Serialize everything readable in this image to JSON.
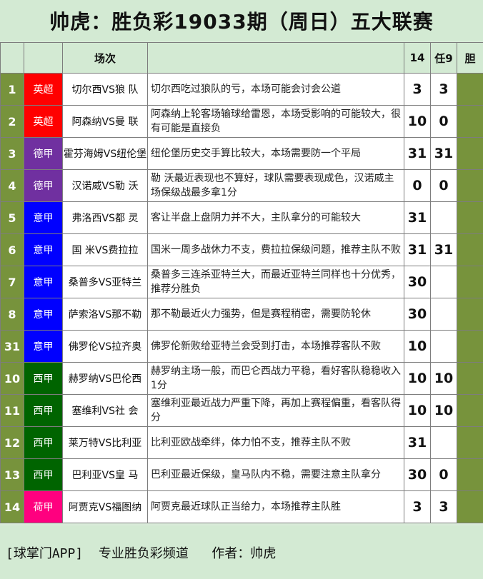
{
  "title": "帅虎：胜负彩19033期（周日）五大联赛",
  "header": {
    "col_match": "场次",
    "col_14": "14",
    "col_r9": "任9",
    "col_dan": "胆"
  },
  "league_colors": {
    "英超": "#ff0000",
    "德甲": "#7030a0",
    "意甲": "#0000ff",
    "西甲": "#006400",
    "荷甲": "#ff007f"
  },
  "rows": [
    {
      "num": "1",
      "league": "英超",
      "match": "切尔西VS狼 队",
      "comment": "切尔西吃过狼队的亏，本场可能会讨会公道",
      "p14": "3",
      "r9": "3"
    },
    {
      "num": "2",
      "league": "英超",
      "match": "阿森纳VS曼 联",
      "comment": "阿森纳上轮客场输球给雷恩，本场受影响的可能较大，很有可能是直接负",
      "p14": "10",
      "r9": "0"
    },
    {
      "num": "3",
      "league": "德甲",
      "match": "霍芬海姆VS纽伦堡",
      "comment": "纽伦堡历史交手算比较大，本场需要防一个平局",
      "p14": "31",
      "r9": "31"
    },
    {
      "num": "4",
      "league": "德甲",
      "match": "汉诺威VS勒 沃",
      "comment": "勒 沃最近表现也不算好，球队需要表现成色，汉诺威主场保级战最多拿1分",
      "p14": "0",
      "r9": "0"
    },
    {
      "num": "5",
      "league": "意甲",
      "match": "弗洛西VS都 灵",
      "comment": "客让半盘上盘阴力并不大，主队拿分的可能较大",
      "p14": "31",
      "r9": ""
    },
    {
      "num": "6",
      "league": "意甲",
      "match": "国 米VS费拉拉",
      "comment": "国米一周多战休力不支，费拉拉保级问题，推荐主队不败",
      "p14": "31",
      "r9": "31"
    },
    {
      "num": "7",
      "league": "意甲",
      "match": "桑普多VS亚特兰",
      "comment": "桑普多三连杀亚特兰大，而最近亚特兰同样也十分优秀，推荐分胜负",
      "p14": "30",
      "r9": ""
    },
    {
      "num": "8",
      "league": "意甲",
      "match": "萨索洛VS那不勒",
      "comment": "那不勒最近火力强势，但是赛程稍密，需要防轮休",
      "p14": "30",
      "r9": ""
    },
    {
      "num": "31",
      "league": "意甲",
      "match": "佛罗伦VS拉齐奥",
      "comment": "佛罗伦新败给亚特兰会受到打击，本场推荐客队不败",
      "p14": "10",
      "r9": ""
    },
    {
      "num": "10",
      "league": "西甲",
      "match": "赫罗纳VS巴伦西",
      "comment": "赫罗纳主场一般，而巴仑西战力平稳，看好客队稳稳收入1分",
      "p14": "10",
      "r9": "10"
    },
    {
      "num": "11",
      "league": "西甲",
      "match": "塞维利VS社 会",
      "comment": "塞维利亚最近战力严重下降，再加上赛程偏重，看客队得分",
      "p14": "10",
      "r9": "10"
    },
    {
      "num": "12",
      "league": "西甲",
      "match": "莱万特VS比利亚",
      "comment": "比利亚欧战牵绊，体力怕不支，推荐主队不败",
      "p14": "31",
      "r9": ""
    },
    {
      "num": "13",
      "league": "西甲",
      "match": "巴利亚VS皇 马",
      "comment": "巴利亚最近保级，皇马队内不稳，需要注意主队拿分",
      "p14": "30",
      "r9": "0"
    },
    {
      "num": "14",
      "league": "荷甲",
      "match": "阿贾克VS福图纳",
      "comment": "阿贾克最近球队正当给力，本场推荐主队胜",
      "p14": "3",
      "r9": "3"
    }
  ],
  "footer": "[球掌门APP]  专业胜负彩频道   作者：帅虎"
}
